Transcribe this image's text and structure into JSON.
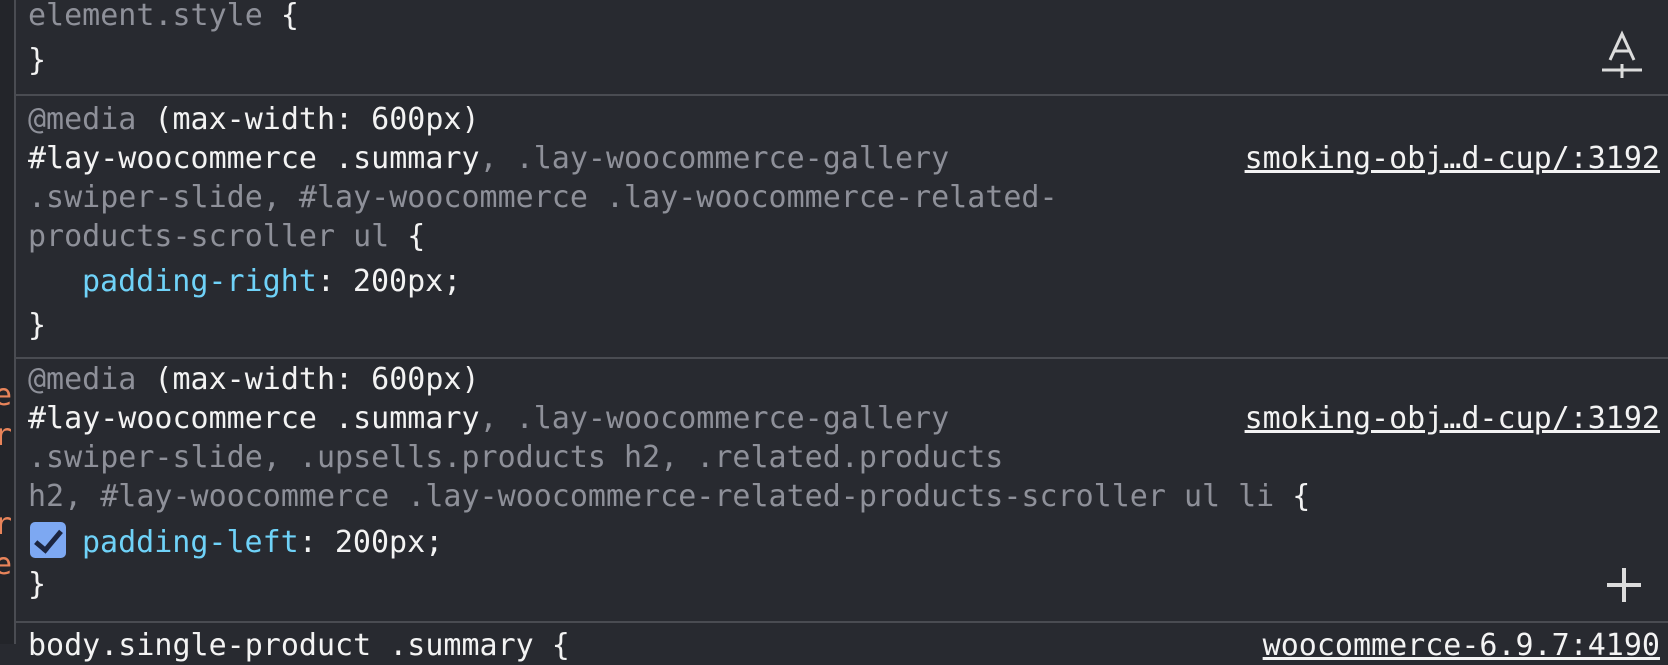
{
  "left_gutter": {
    "letters": [
      "e",
      "r",
      "r",
      "e"
    ]
  },
  "rules": [
    {
      "selector": "element.style",
      "open": " {",
      "close": "}"
    },
    {
      "media": {
        "keyword": "@media",
        "query": " (max-width: 600px)"
      },
      "selector_match": "#lay-woocommerce .summary",
      "selector_rest_1": ", .lay-woocommerce-gallery",
      "selector_rest_2": ".swiper-slide, #lay-woocommerce .lay-woocommerce-related-",
      "selector_rest_3": "products-scroller ul",
      "open": " {",
      "declaration": {
        "property": "padding-right",
        "value": ": 200px;"
      },
      "close": "}",
      "source": "smoking-obj…d-cup/:3192"
    },
    {
      "media": {
        "keyword": "@media",
        "query": " (max-width: 600px)"
      },
      "selector_match": "#lay-woocommerce .summary",
      "selector_rest_1": ", .lay-woocommerce-gallery",
      "selector_rest_2": ".swiper-slide, .upsells.products h2, .related.products",
      "selector_rest_3": "h2, #lay-woocommerce .lay-woocommerce-related-products-scroller ul li",
      "open": " {",
      "declaration": {
        "property": "padding-left",
        "value": ": 200px;",
        "enabled": true
      },
      "close": "}",
      "source": "smoking-obj…d-cup/:3192"
    },
    {
      "selector": "body.single-product .summary",
      "open": " {",
      "source": "woocommerce-6.9.7:4190"
    }
  ],
  "icons": {
    "font_toggle": "font-size-icon",
    "add_rule": "plus-icon"
  }
}
